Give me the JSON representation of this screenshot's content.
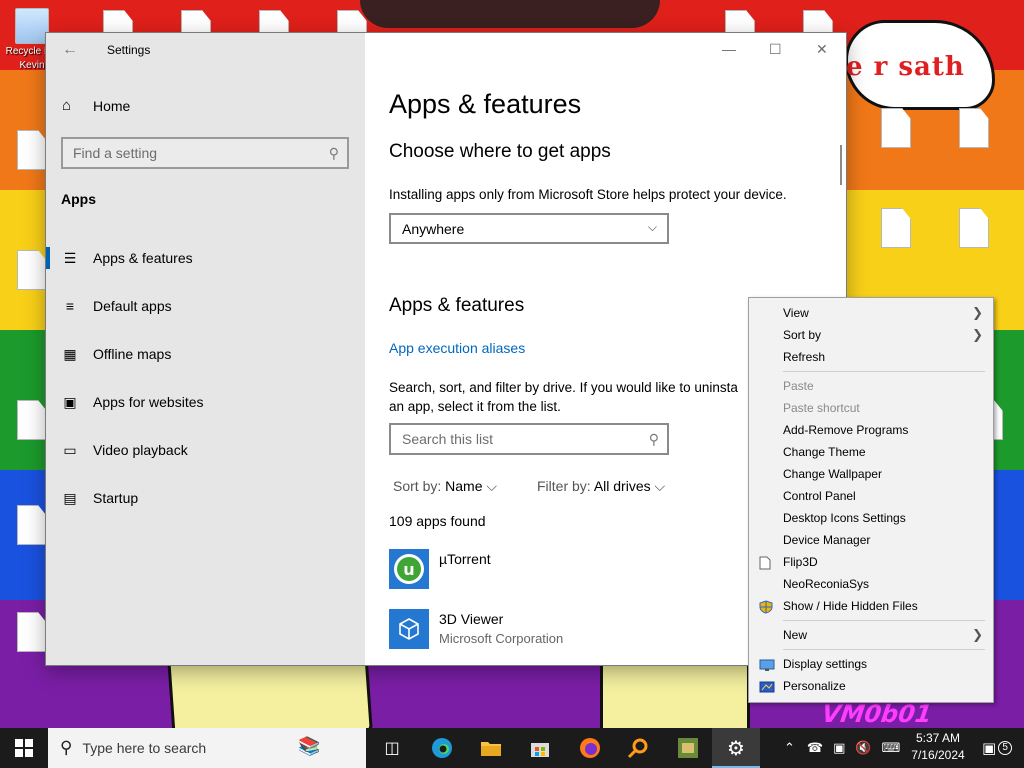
{
  "desktop": {
    "overlay_text": "e r sath",
    "vm_text": "VM0b01",
    "icons": [
      {
        "label": "Recycle Bin"
      },
      {
        "label": "Kevin"
      }
    ]
  },
  "settings": {
    "title": "Settings",
    "home_label": "Home",
    "find_placeholder": "Find a setting",
    "section": "Apps",
    "nav": [
      {
        "label": "Apps & features",
        "icon": "apps-features-icon"
      },
      {
        "label": "Default apps",
        "icon": "default-apps-icon"
      },
      {
        "label": "Offline maps",
        "icon": "offline-maps-icon"
      },
      {
        "label": "Apps for websites",
        "icon": "apps-websites-icon"
      },
      {
        "label": "Video playback",
        "icon": "video-playback-icon"
      },
      {
        "label": "Startup",
        "icon": "startup-icon"
      }
    ],
    "page_title": "Apps & features",
    "choose_heading": "Choose where to get apps",
    "store_note": "Installing apps only from Microsoft Store helps protect your device.",
    "source_select": "Anywhere",
    "features_heading": "Apps & features",
    "aliases_link": "App execution aliases",
    "search_note_1": "Search, sort, and filter by drive. If you would like to uninsta",
    "search_note_2": "an app, select it from the list.",
    "search_placeholder": "Search this list",
    "sort_label": "Sort by:",
    "sort_value": "Name",
    "filter_label": "Filter by:",
    "filter_value": "All drives",
    "apps_found": "109 apps found",
    "apps": [
      {
        "name": "µTorrent",
        "publisher": ""
      },
      {
        "name": "3D Viewer",
        "publisher": "Microsoft Corporation"
      }
    ]
  },
  "context_menu": {
    "items": [
      {
        "label": "View",
        "submenu": true
      },
      {
        "label": "Sort by",
        "submenu": true
      },
      {
        "label": "Refresh"
      },
      {
        "label": "Paste",
        "disabled": true
      },
      {
        "label": "Paste shortcut",
        "disabled": true
      },
      {
        "label": "Add-Remove Programs"
      },
      {
        "label": "Change Theme"
      },
      {
        "label": "Change Wallpaper"
      },
      {
        "label": "Control Panel"
      },
      {
        "label": "Desktop Icons Settings"
      },
      {
        "label": "Device Manager"
      },
      {
        "label": "Flip3D"
      },
      {
        "label": "NeoReconiaSys"
      },
      {
        "label": "Show / Hide Hidden Files"
      },
      {
        "label": "New",
        "submenu": true
      },
      {
        "label": "Display settings"
      },
      {
        "label": "Personalize"
      }
    ]
  },
  "taskbar": {
    "search_placeholder": "Type here to search",
    "time": "5:37 AM",
    "date": "7/16/2024",
    "notifications": "5"
  },
  "colors": {
    "accent": "#0063b1",
    "link": "#0067c0",
    "taskbar": "#1b1b1b"
  }
}
